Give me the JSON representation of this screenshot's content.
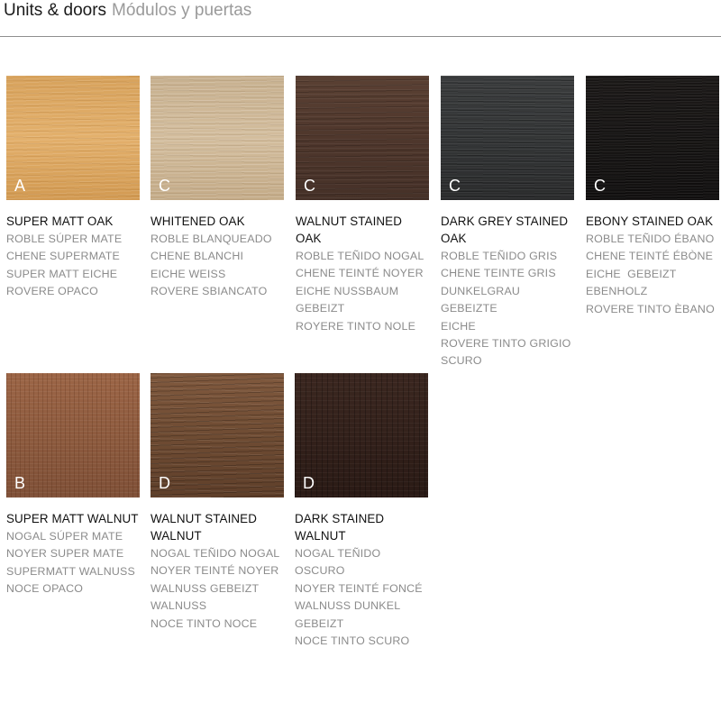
{
  "header": {
    "title_en": "Units & doors",
    "title_es": "Módulos y puertas"
  },
  "swatches": [
    {
      "letter": "A",
      "name": "SUPER MATT OAK",
      "translations": [
        "ROBLE SÚPER MATE",
        "CHENE SUPERMATE",
        "SUPER MATT EICHE",
        "ROVERE OPACO"
      ],
      "color": "#dba766"
    },
    {
      "letter": "C",
      "name": "WHITENED OAK",
      "translations": [
        "ROBLE BLANQUEADO",
        "CHENE BLANCHI",
        "EICHE WEISS",
        "ROVERE SBIANCATO"
      ],
      "color": "#ccb595"
    },
    {
      "letter": "C",
      "name": "WALNUT STAINED OAK",
      "translations": [
        "ROBLE TEÑIDO NOGAL",
        "CHENE TEINTÉ NOYER",
        "EICHE NUSSBAUM",
        "GEBEIZT",
        "ROYERE TINTO NOLE"
      ],
      "color": "#4f372c"
    },
    {
      "letter": "C",
      "name": "DARK GREY STAINED OAK",
      "translations": [
        "ROBLE TEÑIDO GRIS",
        "CHENE TEINTE GRIS",
        "DUNKELGRAU GEBEIZTE",
        "EICHE",
        "ROVERE TINTO GRIGIO",
        "SCURO"
      ],
      "color": "#333536"
    },
    {
      "letter": "C",
      "name": "EBONY STAINED OAK",
      "translations": [
        "ROBLE TEÑIDO ÉBANO",
        "CHENE TEINTÉ ÉBÒNE",
        "EICHE  GEBEIZT",
        "EBENHOLZ",
        "ROVERE TINTO ÈBANO"
      ],
      "color": "#181615"
    },
    {
      "letter": "B",
      "name": "SUPER MATT WALNUT",
      "translations": [
        "NOGAL SÚPER MATE",
        "NOYER SUPER MATE",
        "SUPERMATT WALNUSS",
        "NOCE OPACO"
      ],
      "color": "#8c5a3e"
    },
    {
      "letter": "D",
      "name": "WALNUT STAINED WALNUT",
      "translations": [
        "NOGAL TEÑIDO NOGAL",
        "NOYER TEINTÉ NOYER",
        "WALNUSS GEBEIZT",
        "WALNUSS",
        "NOCE TINTO NOCE"
      ],
      "color": "#6f4c33"
    },
    {
      "letter": "D",
      "name": "DARK STAINED WALNUT",
      "translations": [
        "NOGAL TEÑIDO OSCURO",
        "NOYER TEINTÉ FONCÉ",
        "WALNUSS DUNKEL",
        "GEBEIZT",
        "NOCE TINTO SCURO"
      ],
      "color": "#33211b"
    }
  ]
}
